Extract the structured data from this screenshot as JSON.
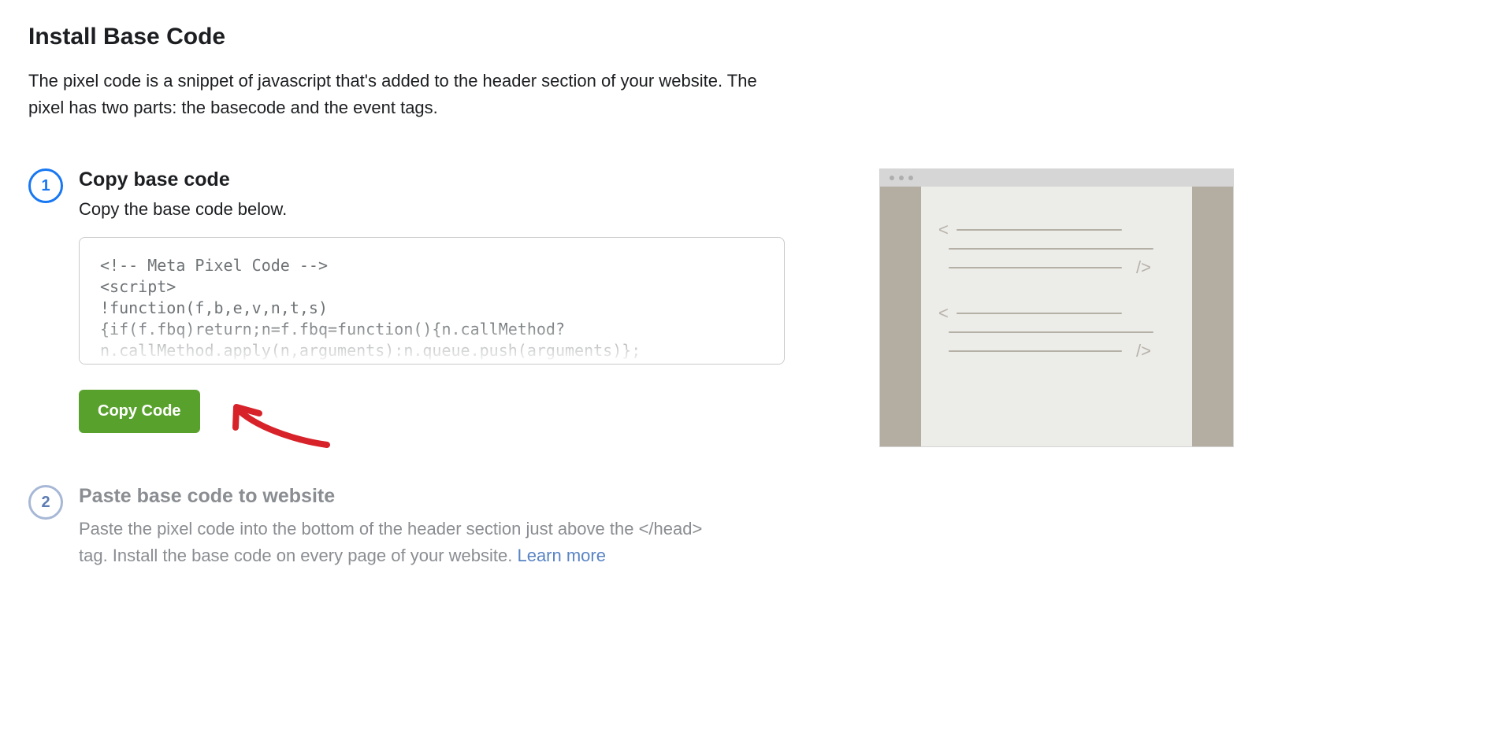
{
  "header": {
    "title": "Install Base Code",
    "description": "The pixel code is a snippet of javascript that's added to the header section of your website. The pixel has two parts: the basecode and the event tags."
  },
  "steps": [
    {
      "number": "1",
      "title": "Copy base code",
      "subtitle": "Copy the base code below.",
      "code": "<!-- Meta Pixel Code -->\n<script>\n!function(f,b,e,v,n,t,s)\n{if(f.fbq)return;n=f.fbq=function(){n.callMethod?\nn.callMethod.apply(n,arguments):n.queue.push(arguments)};",
      "button_label": "Copy Code"
    },
    {
      "number": "2",
      "title": "Paste base code to website",
      "text": "Paste the pixel code into the bottom of the header section just above the </head> tag. Install the base code on every page of your website. ",
      "learn_more": "Learn more"
    }
  ]
}
